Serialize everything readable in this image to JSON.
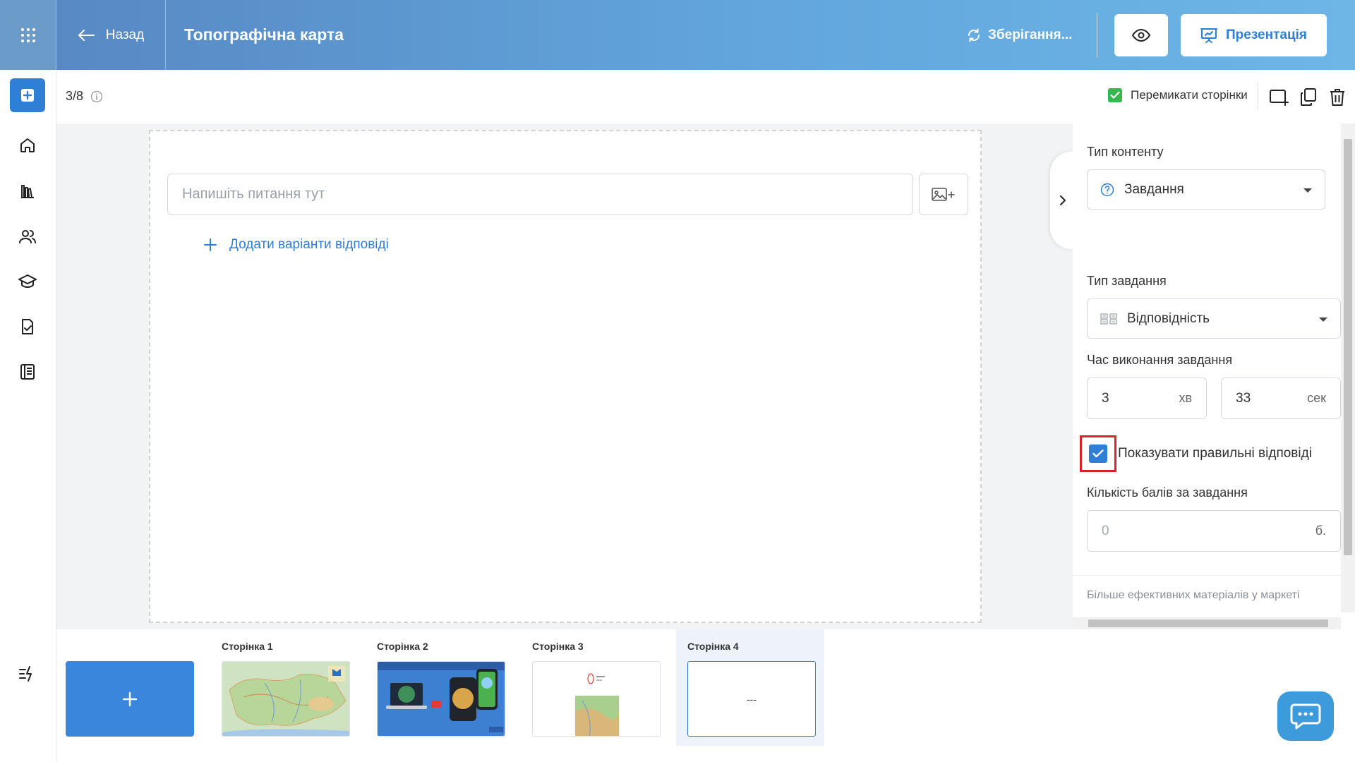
{
  "header": {
    "back_label": "Назад",
    "title": "Топографічна карта",
    "saving_label": "Зберігання...",
    "present_label": "Презентація"
  },
  "toolbar": {
    "page_counter": "3/8",
    "switch_pages_label": "Перемикати сторінки"
  },
  "editor": {
    "question_placeholder": "Напишіть питання тут",
    "add_answers_label": "Додати варіанти відповіді"
  },
  "panel": {
    "content_type_label": "Тип контенту",
    "content_type_value": "Завдання",
    "task_type_label": "Тип завдання",
    "task_type_value": "Відповідність",
    "time_label": "Час виконання завдання",
    "minutes_value": "3",
    "minutes_unit": "хв",
    "seconds_value": "33",
    "seconds_unit": "сек",
    "show_correct_label": "Показувати правильні відповіді",
    "points_label": "Кількість балів за завдання",
    "points_placeholder": "0",
    "points_unit": "б.",
    "market_link": "Більше ефективних матеріалів у маркеті"
  },
  "pages": [
    {
      "label": "Сторінка 1"
    },
    {
      "label": "Сторінка 2"
    },
    {
      "label": "Сторінка 3"
    },
    {
      "label": "Сторінка 4",
      "content": "---"
    }
  ],
  "colors": {
    "accent": "#2f7fd7",
    "check_green": "#36b84f",
    "highlight_red": "#d9232a"
  }
}
